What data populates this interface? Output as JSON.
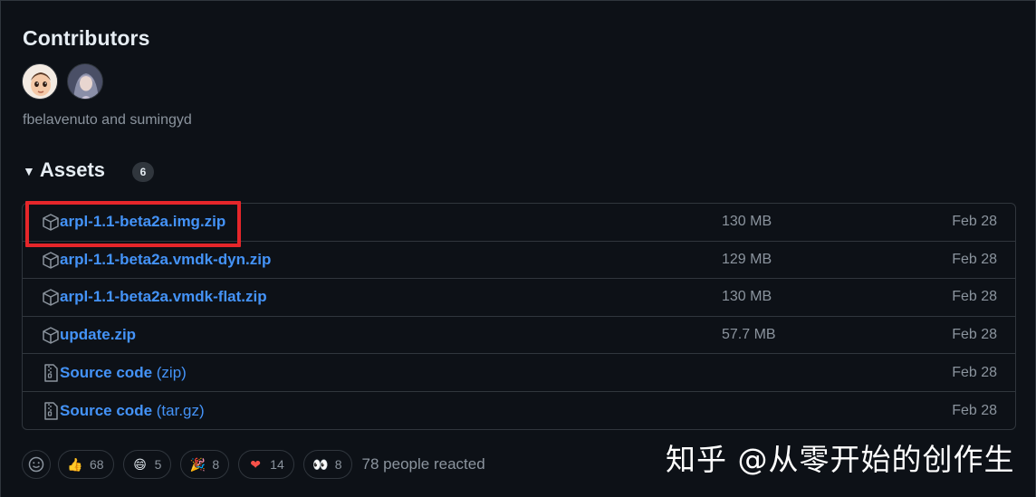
{
  "contributors": {
    "title": "Contributors",
    "names": "fbelavenuto and sumingyd"
  },
  "assets": {
    "title": "Assets",
    "count": "6",
    "items": [
      {
        "name": "arpl-1.1-beta2a.img.zip",
        "suffix": "",
        "size": "130 MB",
        "date": "Feb 28",
        "icon": "package-icon"
      },
      {
        "name": "arpl-1.1-beta2a.vmdk-dyn.zip",
        "suffix": "",
        "size": "129 MB",
        "date": "Feb 28",
        "icon": "package-icon"
      },
      {
        "name": "arpl-1.1-beta2a.vmdk-flat.zip",
        "suffix": "",
        "size": "130 MB",
        "date": "Feb 28",
        "icon": "package-icon"
      },
      {
        "name": "update.zip",
        "suffix": "",
        "size": "57.7 MB",
        "date": "Feb 28",
        "icon": "package-icon"
      },
      {
        "name": "Source code",
        "suffix": " (zip)",
        "size": "",
        "date": "Feb 28",
        "icon": "file-zip-icon"
      },
      {
        "name": "Source code",
        "suffix": " (tar.gz)",
        "size": "",
        "date": "Feb 28",
        "icon": "file-zip-icon"
      }
    ]
  },
  "reactions": {
    "items": [
      {
        "emoji": "👍",
        "count": "68",
        "name": "thumbs-up"
      },
      {
        "emoji": "😄",
        "count": "5",
        "name": "laugh"
      },
      {
        "emoji": "🎉",
        "count": "8",
        "name": "hooray"
      },
      {
        "emoji": "❤",
        "count": "14",
        "name": "heart"
      },
      {
        "emoji": "👀",
        "count": "8",
        "name": "eyes"
      }
    ],
    "summary": "78 people reacted"
  },
  "watermark": "知乎 @从零开始的创作生",
  "colors": {
    "background": "#0d1117",
    "border": "#30363d",
    "link": "#4493f8",
    "muted": "#8b949e",
    "highlight": "#e5262a"
  }
}
